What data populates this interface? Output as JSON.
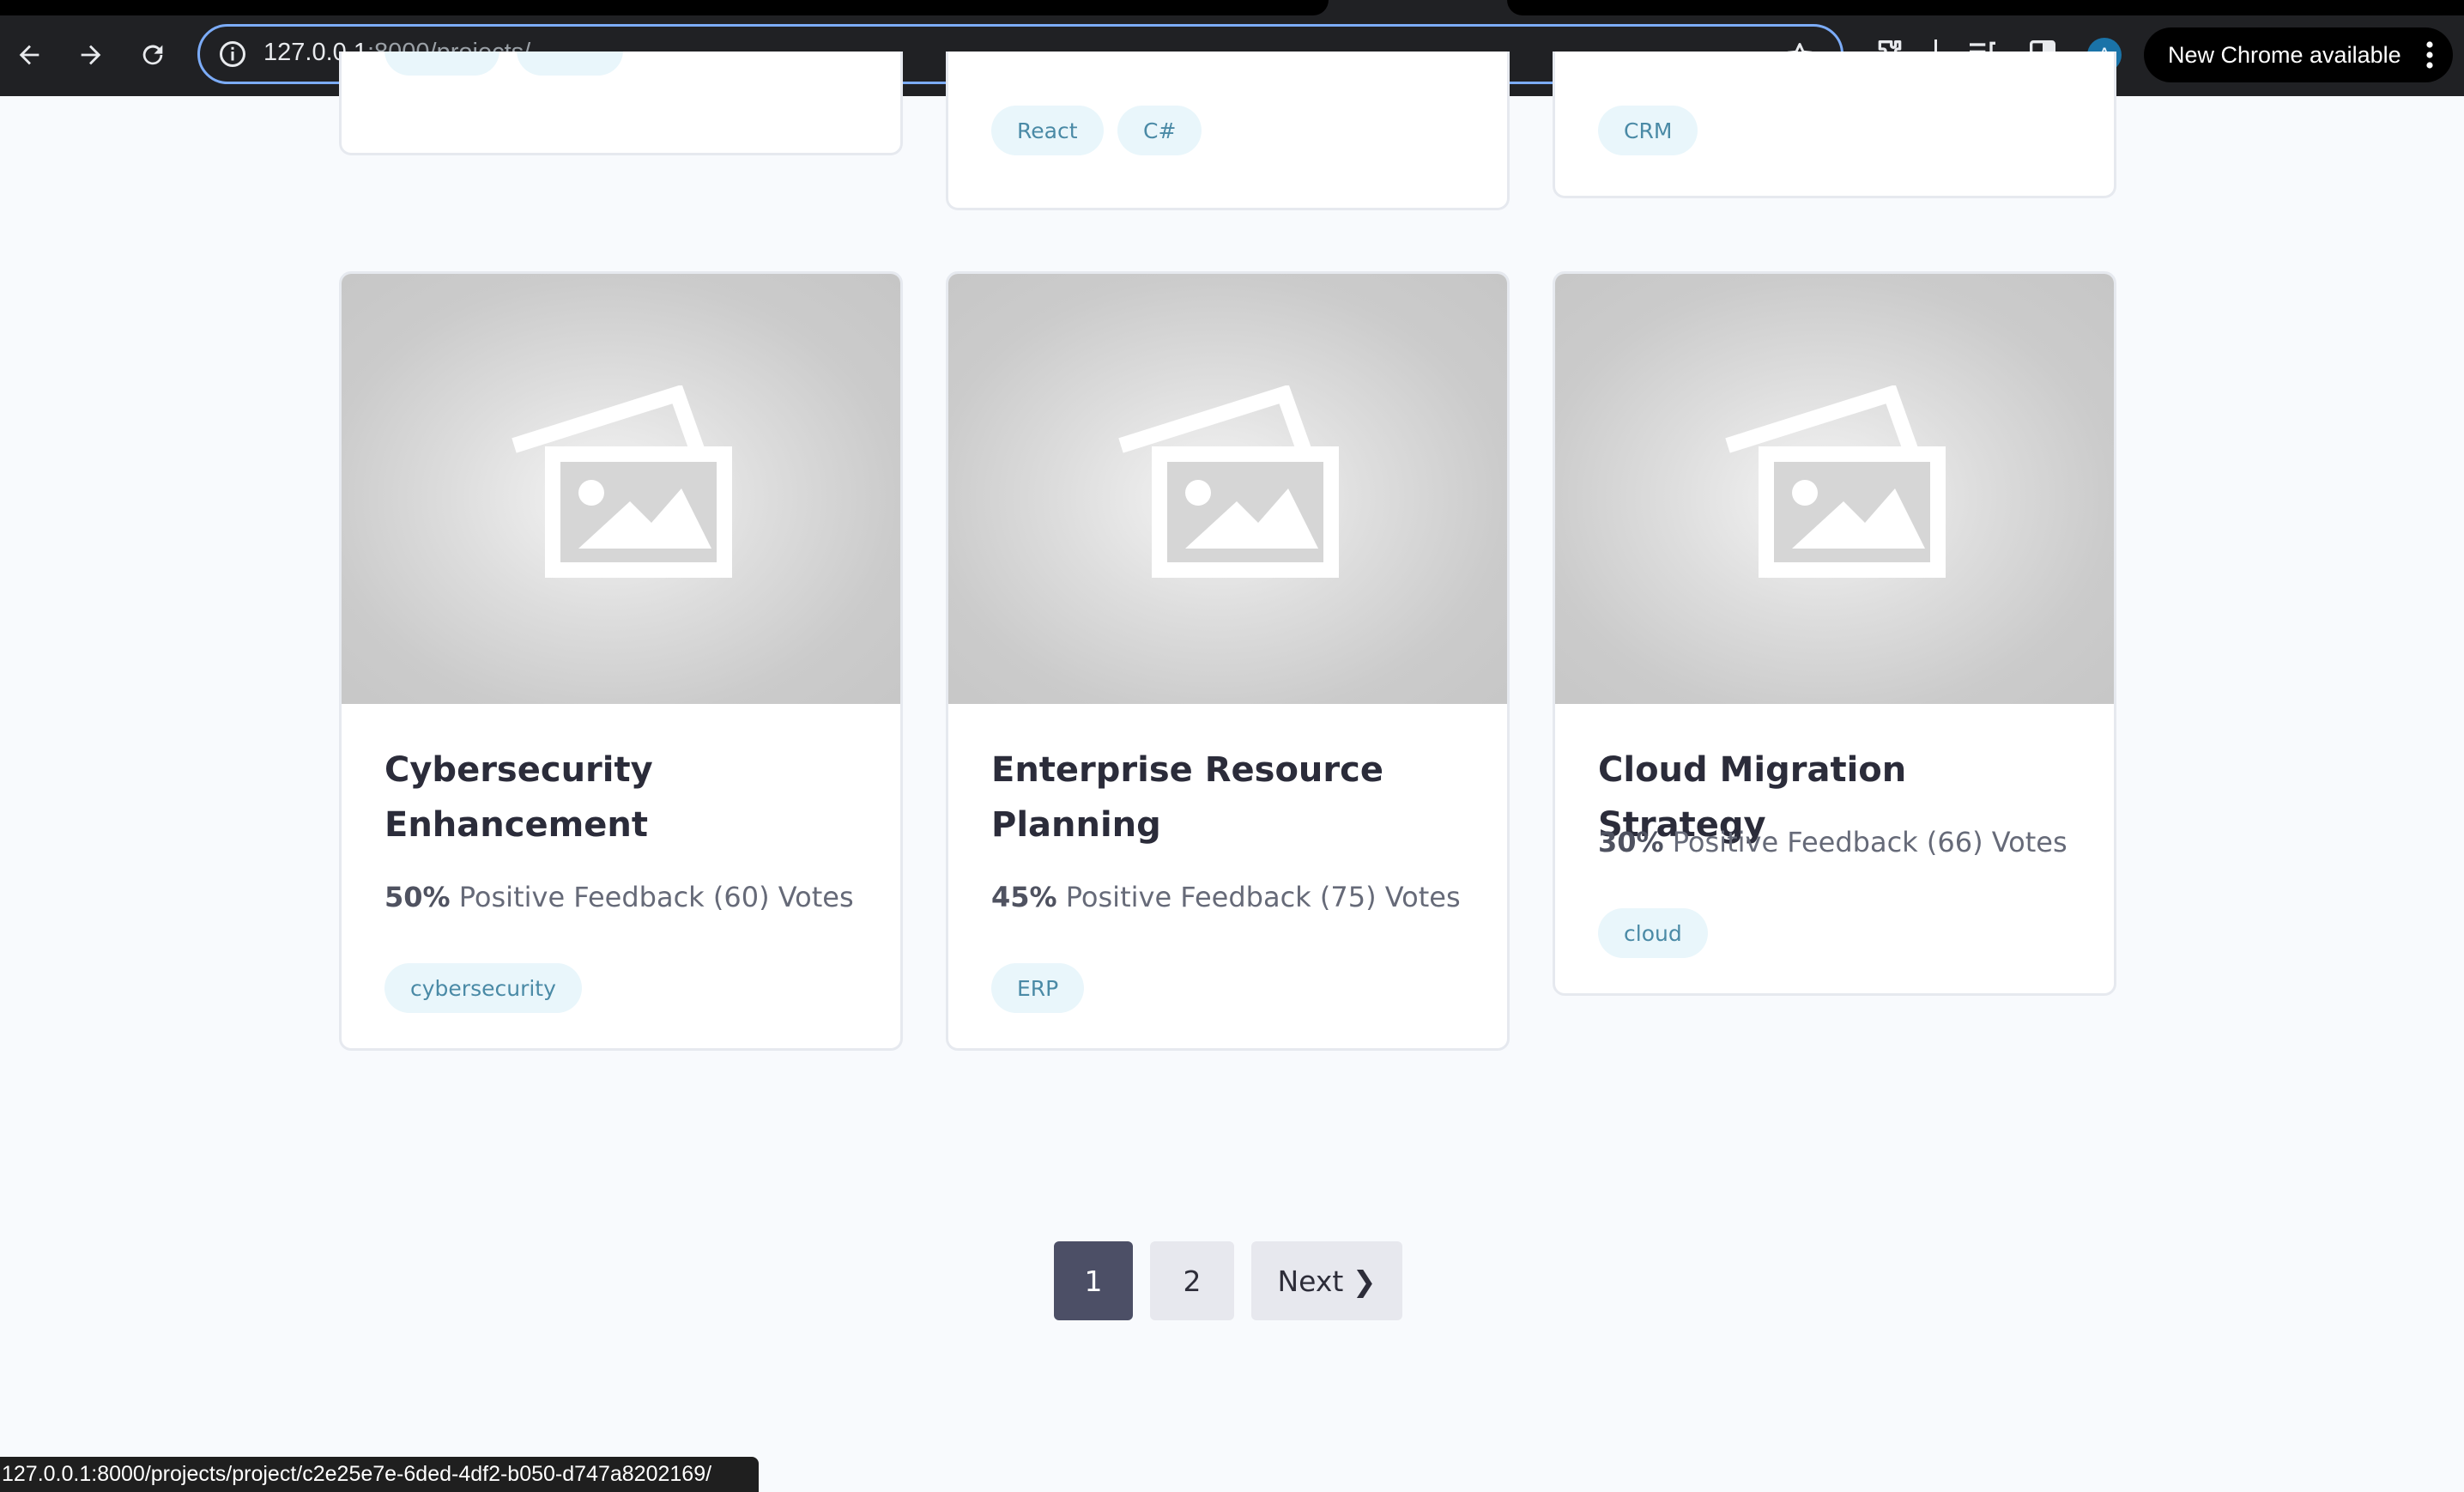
{
  "browser": {
    "url_host": "127.0.0.1",
    "url_rest": ":8000/projects/",
    "update_button": "New Chrome available",
    "profile_initial": "A"
  },
  "top_cards": [
    {
      "tags": []
    },
    {
      "tags": [
        "React",
        "C#"
      ]
    },
    {
      "tags": [
        "CRM"
      ]
    }
  ],
  "projects": [
    {
      "title": "Cybersecurity Enhancement",
      "percent": "50%",
      "feedback_text": "Positive Feedback (60) Votes",
      "tags": [
        "cybersecurity"
      ]
    },
    {
      "title": "Enterprise Resource Planning",
      "percent": "45%",
      "feedback_text": "Positive Feedback (75) Votes",
      "tags": [
        "ERP"
      ]
    },
    {
      "title": "Cloud Migration Strategy",
      "percent": "30%",
      "feedback_text": "Positive Feedback (66) Votes",
      "tags": [
        "cloud"
      ]
    }
  ],
  "pagination": {
    "pages": [
      "1",
      "2"
    ],
    "current_page": "1",
    "next_label": "Next ❯"
  },
  "status_bar": {
    "link": "127.0.0.1:8000/projects/project/c2e25e7e-6ded-4df2-b050-d747a8202169/"
  },
  "colors": {
    "tag_bg": "#e9f6fb",
    "tag_text": "#4a8aa6",
    "active_page": "#4c4f66",
    "omnibox_focus": "#7cacf8"
  }
}
